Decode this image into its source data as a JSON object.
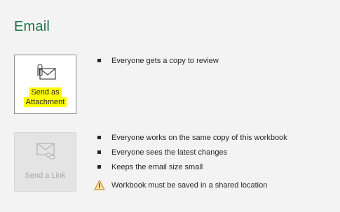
{
  "section": {
    "title": "Email"
  },
  "attachment": {
    "label_line1": "Send as",
    "label_line2": "Attachment",
    "icon": "envelope-paperclip-icon",
    "highlight_color": "#ffff00",
    "bullets": [
      "Everyone gets a copy to review"
    ]
  },
  "link": {
    "label": "Send a Link",
    "icon": "envelope-link-icon",
    "state": "disabled",
    "bullets": [
      "Everyone works on the same copy of this workbook",
      "Everyone sees the latest changes",
      "Keeps the email size small"
    ],
    "warning": "Workbook must be saved in a shared location"
  },
  "colors": {
    "accent": "#217346",
    "warning": "#e8a33a"
  }
}
